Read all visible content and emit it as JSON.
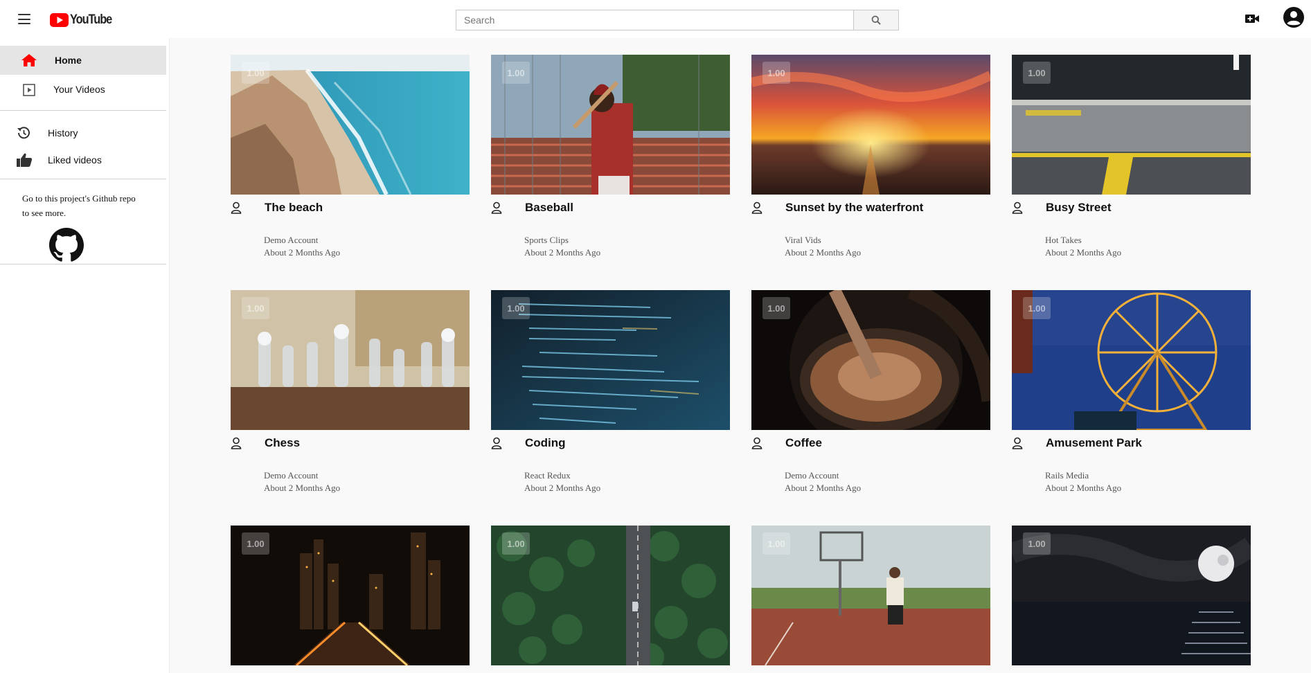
{
  "header": {
    "logo_text": "YouTube",
    "search": {
      "placeholder": "Search",
      "value": ""
    },
    "brand_color": "#ff0000"
  },
  "sidebar": {
    "items": [
      {
        "label": "Home",
        "icon": "home-icon",
        "active": true
      },
      {
        "label": "Your Videos",
        "icon": "play-square-icon",
        "active": false
      },
      {
        "label": "History",
        "icon": "history-icon",
        "active": false
      },
      {
        "label": "Liked videos",
        "icon": "thumbs-up-icon",
        "active": false
      }
    ],
    "github_text": "Go to this project's Github repo to see more.",
    "github_icon": "github-icon"
  },
  "videos": [
    {
      "title": "The beach",
      "channel": "Demo Account",
      "age": "About 2 Months Ago",
      "speed": "1.00"
    },
    {
      "title": "Baseball",
      "channel": "Sports Clips",
      "age": "About 2 Months Ago",
      "speed": "1.00"
    },
    {
      "title": "Sunset by the waterfront",
      "channel": "Viral Vids",
      "age": "About 2 Months Ago",
      "speed": "1.00"
    },
    {
      "title": "Busy Street",
      "channel": "Hot Takes",
      "age": "About 2 Months Ago",
      "speed": "1.00"
    },
    {
      "title": "Chess",
      "channel": "Demo Account",
      "age": "About 2 Months Ago",
      "speed": "1.00"
    },
    {
      "title": "Coding",
      "channel": "React Redux",
      "age": "About 2 Months Ago",
      "speed": "1.00"
    },
    {
      "title": "Coffee",
      "channel": "Demo Account",
      "age": "About 2 Months Ago",
      "speed": "1.00"
    },
    {
      "title": "Amusement Park",
      "channel": "Rails Media",
      "age": "About 2 Months Ago",
      "speed": "1.00"
    },
    {
      "title": "",
      "channel": "",
      "age": "",
      "speed": "1.00"
    },
    {
      "title": "",
      "channel": "",
      "age": "",
      "speed": "1.00"
    },
    {
      "title": "",
      "channel": "",
      "age": "",
      "speed": "1.00"
    },
    {
      "title": "",
      "channel": "",
      "age": "",
      "speed": "1.00"
    }
  ]
}
